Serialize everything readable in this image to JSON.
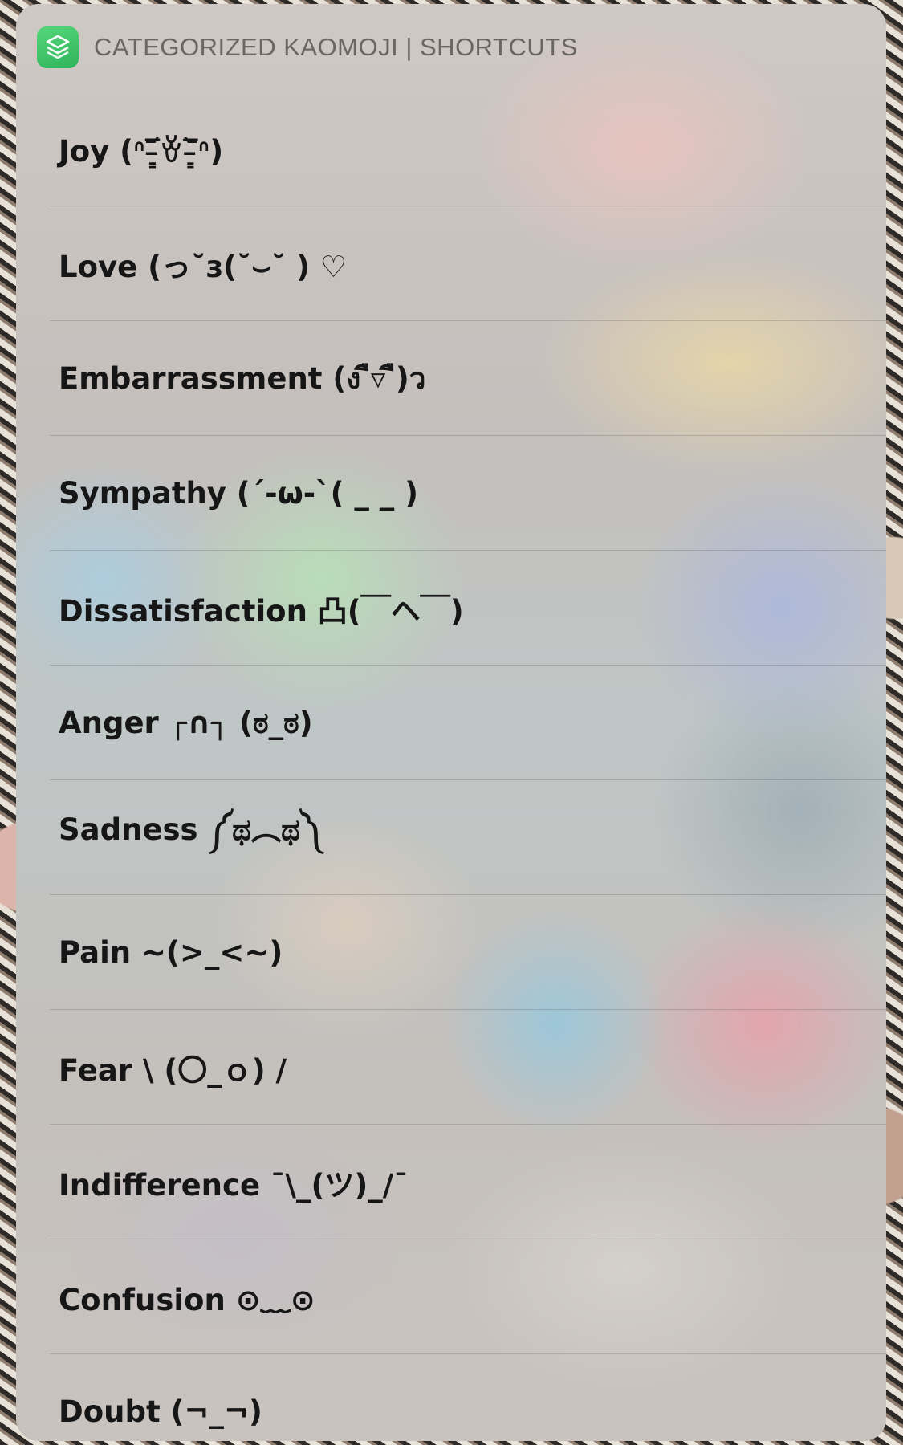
{
  "header": {
    "title": "CATEGORIZED KAOMOJI | SHORTCUTS",
    "icon": "shortcuts-app-icon",
    "accent": "#3cc466"
  },
  "items": [
    {
      "label": "Joy (ᐢ‾̵͇᷄ꈊ‾̵͇᷅ᐢ)"
    },
    {
      "label": "Love (っ˘з(˘⌣˘ ) ♡"
    },
    {
      "label": "Embarrassment (ง ื▿ ื)ว"
    },
    {
      "label": "Sympathy (´-ω-`( _ _ )"
    },
    {
      "label": "Dissatisfaction 凸(￣ヘ￣)"
    },
    {
      "label": "Anger  ┌∩┐ (ಠ_ಠ)"
    },
    {
      "label": "Sadness ༼ಥ︵ಥ༽"
    },
    {
      "label": "Pain ~(>_<~)"
    },
    {
      "label": "Fear  \\ (〇_ｏ) /"
    },
    {
      "label": "Indifference ¯\\_(ツ)_/¯"
    },
    {
      "label": "Confusion ⊙﹏⊙"
    },
    {
      "label": "Doubt (¬_¬)"
    }
  ]
}
